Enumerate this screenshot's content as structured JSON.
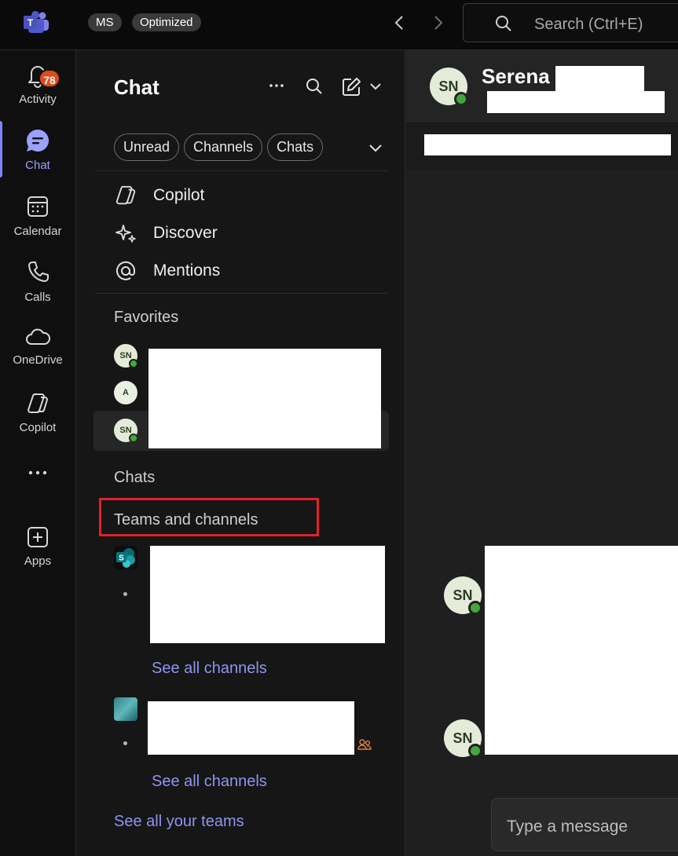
{
  "topbar": {
    "pill_ms": "MS",
    "pill_optimized": "Optimized",
    "search_placeholder": "Search (Ctrl+E)"
  },
  "rail": {
    "activity": {
      "label": "Activity",
      "badge": "78"
    },
    "chat": {
      "label": "Chat"
    },
    "calendar": {
      "label": "Calendar"
    },
    "calls": {
      "label": "Calls"
    },
    "onedrive": {
      "label": "OneDrive"
    },
    "copilot": {
      "label": "Copilot"
    },
    "apps": {
      "label": "Apps"
    }
  },
  "pane": {
    "title": "Chat",
    "filters": [
      "Unread",
      "Channels",
      "Chats"
    ],
    "quick": {
      "copilot": "Copilot",
      "discover": "Discover",
      "mentions": "Mentions"
    },
    "favorites_label": "Favorites",
    "favorites": [
      {
        "initials": "SN"
      },
      {
        "initials": "A"
      },
      {
        "initials": "SN"
      }
    ],
    "chats_label": "Chats",
    "teams_label": "Teams and channels",
    "see_all_channels_1": "See all channels",
    "see_all_channels_2": "See all channels",
    "see_all_teams": "See all your teams"
  },
  "conversation": {
    "avatar_initials": "SN",
    "name": "Serena",
    "message_avatar_1": "SN",
    "message_avatar_2": "SN",
    "compose_placeholder": "Type a message"
  },
  "colors": {
    "accent": "#7f85f5",
    "link": "#8f94f2",
    "badge": "#e04a1a",
    "presence_available": "#41a83a",
    "highlight_box": "#e0212b"
  }
}
